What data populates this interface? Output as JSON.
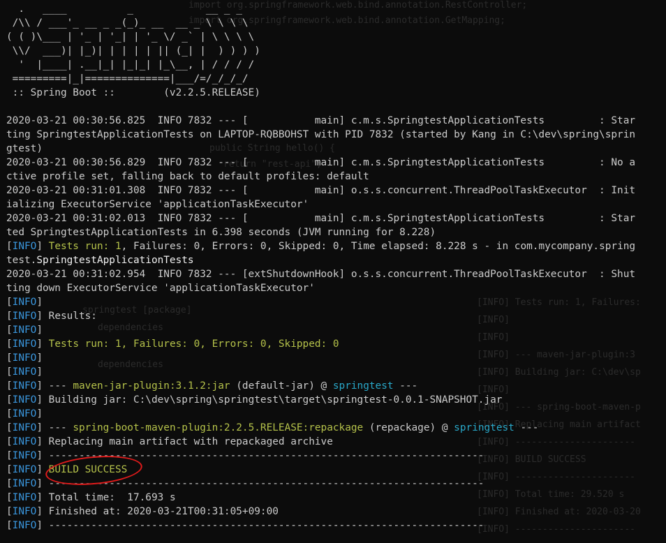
{
  "background_ghost": [
    "import org.springframework.web.bind.annotation.RestController;",
    "import org.springframework.web.bind.annotation.GetMapping;",
    "public String hello() {",
    "return \"rest-api\";",
    "springtest [package]",
    "dependencies",
    "dependencies",
    "[INFO] Tests run: 1, Failures:",
    "[INFO]",
    "[INFO]",
    "[INFO] --- maven-jar-plugin:3",
    "[INFO] Building jar: C:\\dev\\sp",
    "[INFO]",
    "[INFO] --- spring-boot-maven-p",
    "[INFO] Replacing main artifact",
    "[INFO] ----------------------",
    "[INFO] BUILD SUCCESS",
    "[INFO] ----------------------",
    "[INFO] Total time: 29.520 s",
    "[INFO] Finished at: 2020-03-20",
    "[INFO] ----------------------"
  ],
  "banner": [
    "  .   ____          _            __ _ _",
    " /\\\\ / ___'_ __ _ _(_)_ __  __ _ \\ \\ \\ \\",
    "( ( )\\___ | '_ | '_| | '_ \\/ _` | \\ \\ \\ \\",
    " \\\\/  ___)| |_)| | | | | || (_| |  ) ) ) )",
    "  '  |____| .__|_| |_|_| |_\\__, | / / / /",
    " =========|_|==============|___/=/_/_/_/",
    " :: Spring Boot ::        (v2.2.5.RELEASE)"
  ],
  "log": [
    "2020-03-21 00:30:56.825  INFO 7832 --- [           main] c.m.s.SpringtestApplicationTests         : Star",
    "ting SpringtestApplicationTests on LAPTOP-RQBBOHST with PID 7832 (started by Kang in C:\\dev\\spring\\sprin",
    "gtest)",
    "2020-03-21 00:30:56.829  INFO 7832 --- [           main] c.m.s.SpringtestApplicationTests         : No a",
    "ctive profile set, falling back to default profiles: default",
    "2020-03-21 00:31:01.308  INFO 7832 --- [           main] o.s.s.concurrent.ThreadPoolTaskExecutor  : Init",
    "ializing ExecutorService 'applicationTaskExecutor'",
    "2020-03-21 00:31:02.013  INFO 7832 --- [           main] c.m.s.SpringtestApplicationTests         : Star",
    "ted SpringtestApplicationTests in 6.398 seconds (JVM running for 8.228)"
  ],
  "info_tag": "INFO",
  "tests_line": {
    "prefix": "Tests run: ",
    "count": "1",
    "rest": ", Failures: 0, Errors: 0, Skipped: 0, Time elapsed: 8.228 s - in com.mycompany.spring",
    "cont_plain": "test.",
    "cont_bold": "SpringtestApplicationTests"
  },
  "shutdown": [
    "2020-03-21 00:31:02.954  INFO 7832 --- [extShutdownHook] o.s.s.concurrent.ThreadPoolTaskExecutor  : Shut",
    "ting down ExecutorService 'applicationTaskExecutor'"
  ],
  "results_label": " Results:",
  "results_summary": " Tests run: 1, Failures: 0, Errors: 0, Skipped: 0",
  "jar_plugin": {
    "dashes1": " --- ",
    "plugin": "maven-jar-plugin:3.1.2:jar",
    "goal": " (default-jar) @ ",
    "project": "springtest",
    "dashes2": " ---"
  },
  "building_jar": " Building jar: C:\\dev\\spring\\springtest\\target\\springtest-0.0.1-SNAPSHOT.jar",
  "boot_plugin": {
    "dashes1": " --- ",
    "plugin": "spring-boot-maven-plugin:2.2.5.RELEASE:repackage",
    "goal": " (repackage) @ ",
    "project": "springtest",
    "dashes2": " ---"
  },
  "replacing": " Replacing main artifact with repackaged archive",
  "separator": " ------------------------------------------------------------------------",
  "build_success": " BUILD SUCCESS",
  "total_time": " Total time:  17.693 s",
  "finished_at": " Finished at: 2020-03-21T00:31:05+09:00",
  "colors": {
    "background": "#0c0c0c",
    "text": "#cccccc",
    "info": "#3a96dd",
    "success": "#b5c24a",
    "plugin": "#13a10e",
    "project": "#29a8c9",
    "annotation_ring": "#e01b1b"
  }
}
